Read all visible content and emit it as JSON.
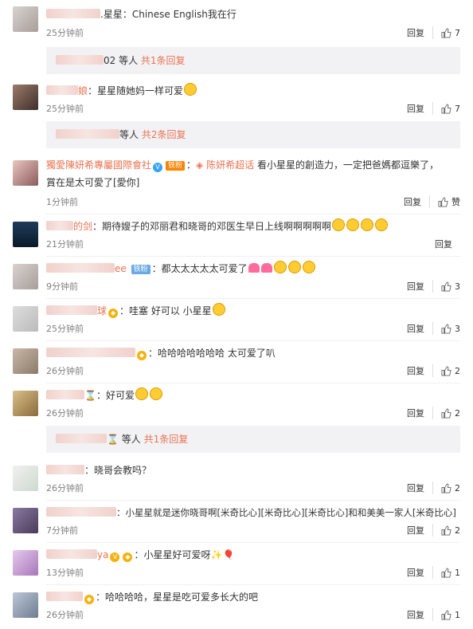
{
  "comments": [
    {
      "time": "25分钟前",
      "reply": "回复",
      "likes": "7",
      "text": "星星：Chinese English我在行",
      "prefix": "."
    },
    {
      "time": "25分钟前",
      "reply": "回复",
      "likes": "7",
      "name_tail": "娘",
      "text": "：星星随她妈一样可爱"
    },
    {
      "time": "1分钟前",
      "reply": "回复",
      "likes": "赞",
      "name": "獨愛陳妍希專屬國際會社",
      "fan_badge": "铁粉",
      "topic": "陈妍希超话",
      "text_line1": "看小星星的創造力，一定把爸媽都逗樂了，",
      "text_line2": "賞在是太可愛了[愛你]"
    },
    {
      "time": "21分钟前",
      "reply": "回复",
      "likes": "",
      "name_tail": "的剑",
      "text": "：期待嫂子的邓丽君和晓哥的邓医生早日上线啊啊啊啊啊"
    },
    {
      "time": "9分钟前",
      "reply": "回复",
      "likes": "3",
      "name_tail": "ee",
      "fan_badge": "铁粉",
      "text": "：都太太太太太可爱了"
    },
    {
      "time": "25分钟前",
      "reply": "回复",
      "likes": "3",
      "name_tail": "球",
      "text": "：哇塞 好可以 小星星"
    },
    {
      "time": "26分钟前",
      "reply": "回复",
      "likes": "2",
      "text": "：哈哈哈哈哈哈哈   太可爱了叭"
    },
    {
      "time": "26分钟前",
      "reply": "回复",
      "likes": "2",
      "text": "：好可爱"
    },
    {
      "time": "26分钟前",
      "reply": "回复",
      "likes": "2",
      "text": "：晓哥会教吗？"
    },
    {
      "time": "7分钟前",
      "reply": "回复",
      "likes": "2",
      "text": "：小星星就是迷你晓哥啊[米奇比心][米奇比心][米奇比心]和和美美一家人[米奇比心]"
    },
    {
      "time": "13分钟前",
      "reply": "回复",
      "likes": "1",
      "name_tail": "ya",
      "text": "：小星星好可爱呀"
    },
    {
      "time": "26分钟前",
      "reply": "回复",
      "likes": "1",
      "text": "：哈哈哈哈，星星是吃可爱多长大的吧"
    }
  ],
  "subreplies": [
    {
      "name_tail": "02",
      "text": " 等人 ",
      "link": "共1条回复"
    },
    {
      "name_tail": "等人",
      "text": " ",
      "link": "共2条回复"
    },
    {
      "name_tail": "",
      "text": " 等人 ",
      "link": "共1条回复"
    }
  ],
  "colors": {
    "accent": "#eb7350",
    "meta": "#808080",
    "subreply_bg": "#f2f2f5"
  }
}
